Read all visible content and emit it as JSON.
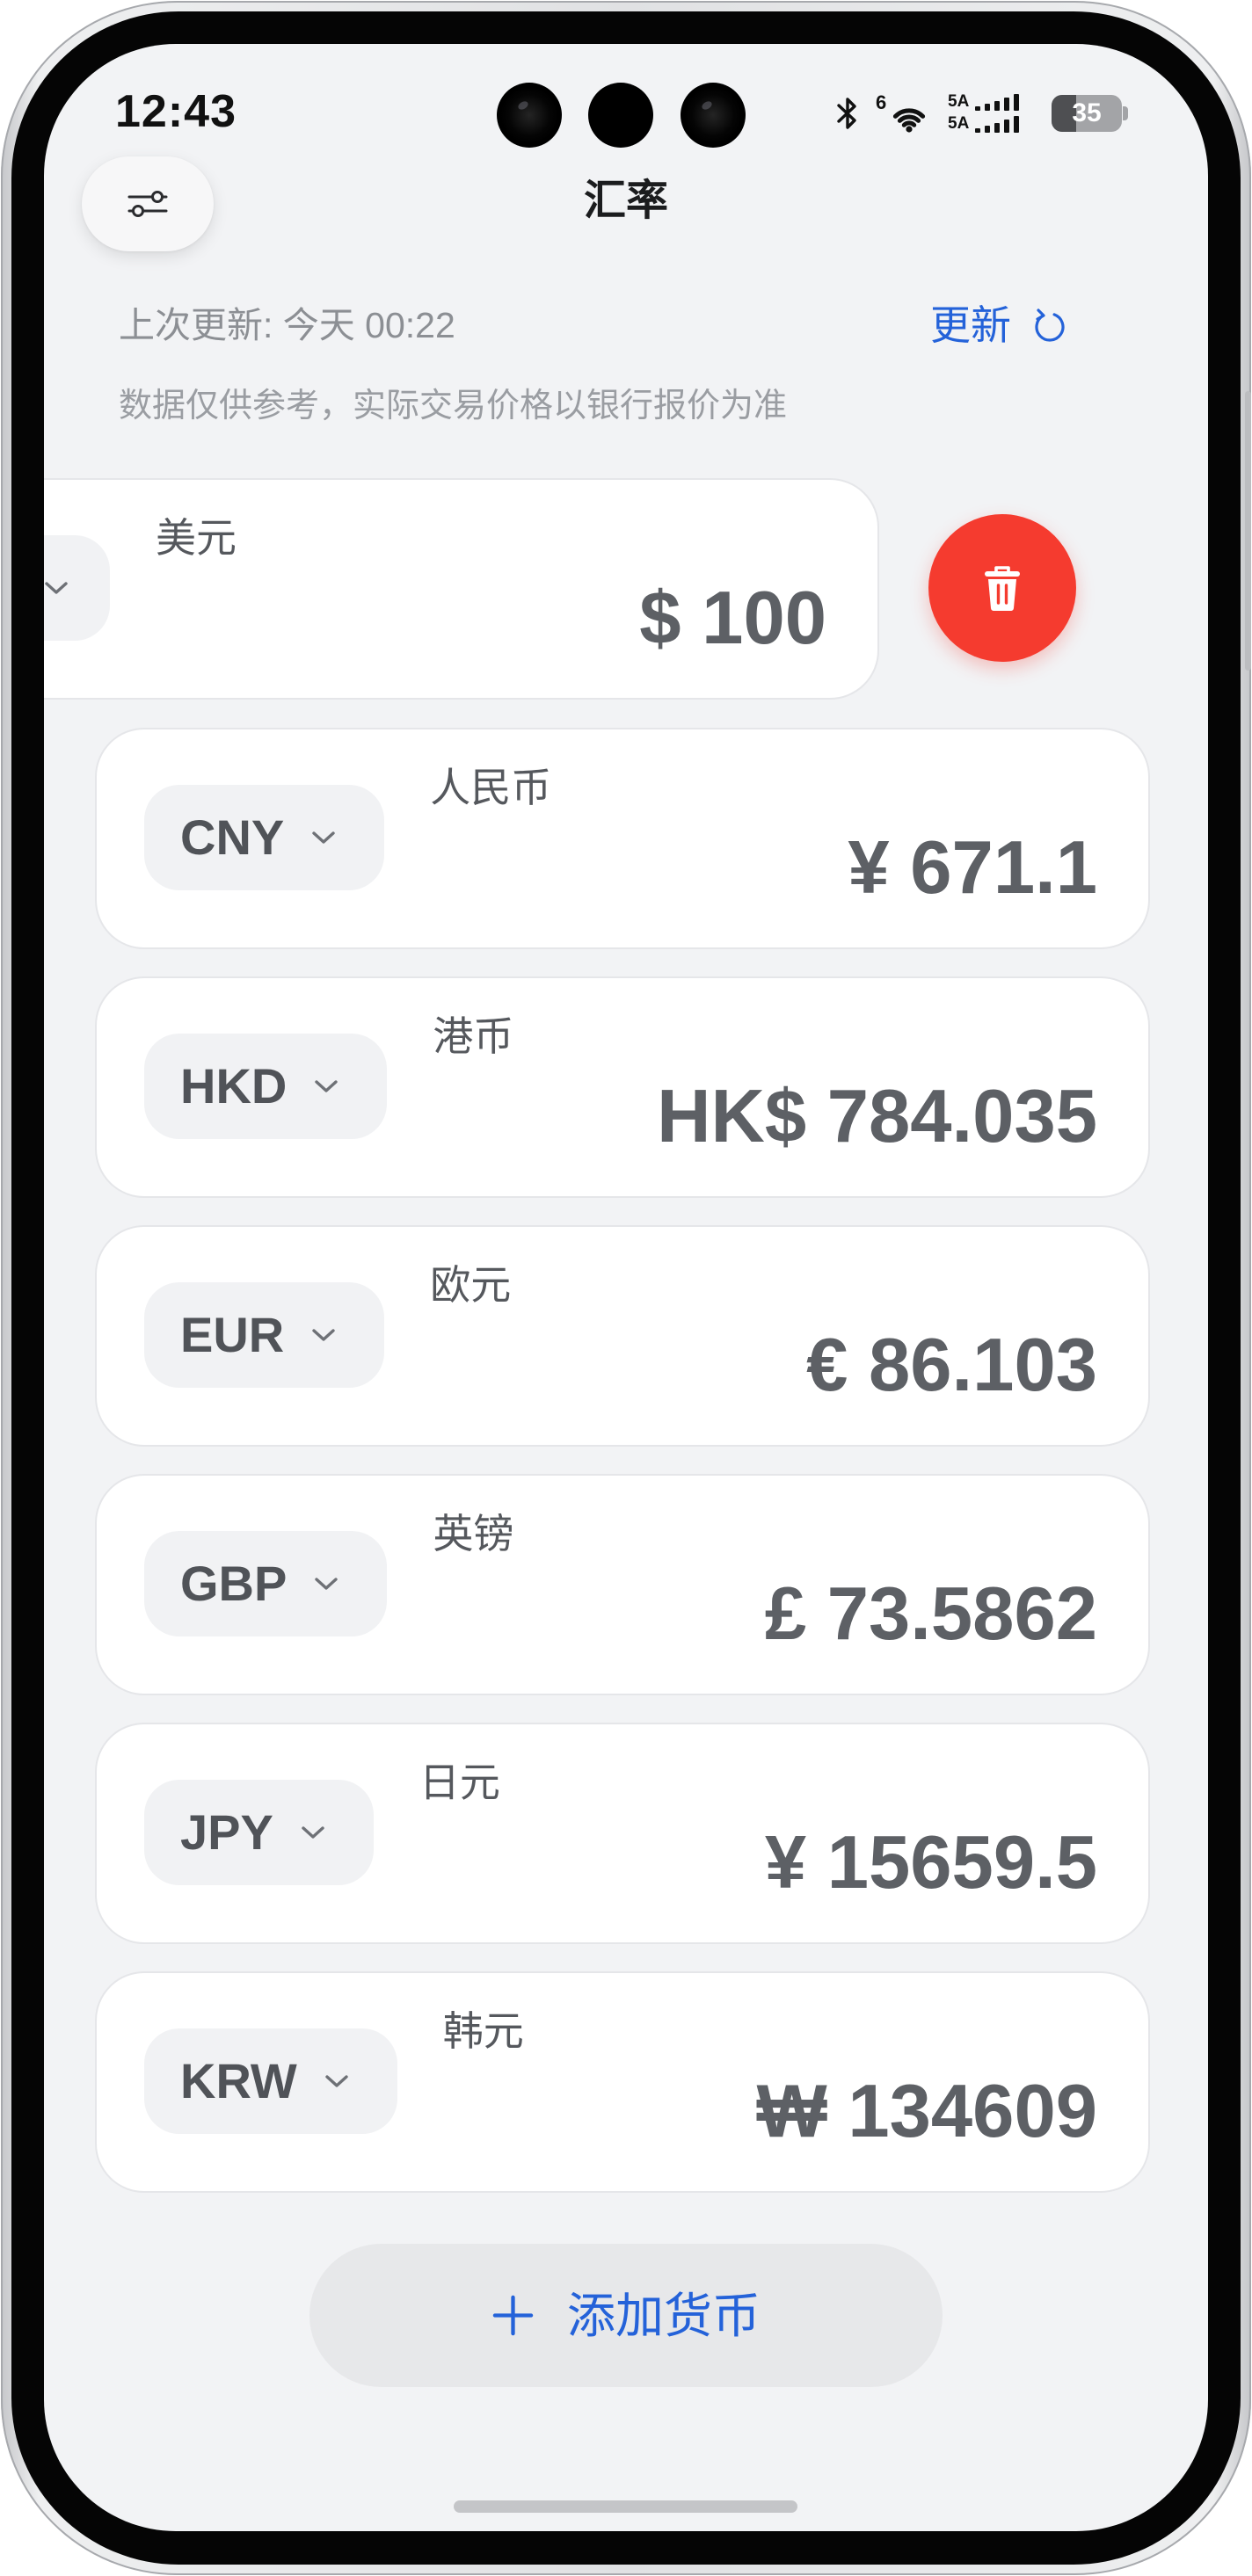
{
  "status_bar": {
    "time": "12:43",
    "wifi_badge": "6",
    "sim1_label": "5A",
    "sim2_label": "5A",
    "battery_level": "35",
    "icons": {
      "bluetooth": "bluetooth-icon",
      "wifi": "wifi-icon",
      "signal": "signal-icon",
      "battery": "battery-icon"
    }
  },
  "header": {
    "title": "汇率",
    "settings_icon": "sliders-icon"
  },
  "info": {
    "last_update": "上次更新: 今天 00:22",
    "refresh_label": "更新",
    "refresh_icon": "refresh-icon",
    "disclaimer": "数据仅供参考，实际交易价格以银行报价为准"
  },
  "base_currency": {
    "name": "美元",
    "amount": "$ 100",
    "dropdown_icon": "chevron-down-icon",
    "delete_icon": "trash-icon"
  },
  "currencies": [
    {
      "code": "CNY",
      "name": "人民币",
      "amount": "¥ 671.1"
    },
    {
      "code": "HKD",
      "name": "港币",
      "amount": "HK$ 784.035"
    },
    {
      "code": "EUR",
      "name": "欧元",
      "amount": "€ 86.103"
    },
    {
      "code": "GBP",
      "name": "英镑",
      "amount": "£ 73.5862"
    },
    {
      "code": "JPY",
      "name": "日元",
      "amount": "¥ 15659.5"
    },
    {
      "code": "KRW",
      "name": "韩元",
      "amount": "₩ 134609"
    }
  ],
  "add_button": {
    "label": "添加货币",
    "icon": "plus-icon"
  },
  "colors": {
    "accent": "#2462d9",
    "danger": "#f53b2f",
    "background": "#f2f3f5",
    "card": "#ffffff"
  }
}
